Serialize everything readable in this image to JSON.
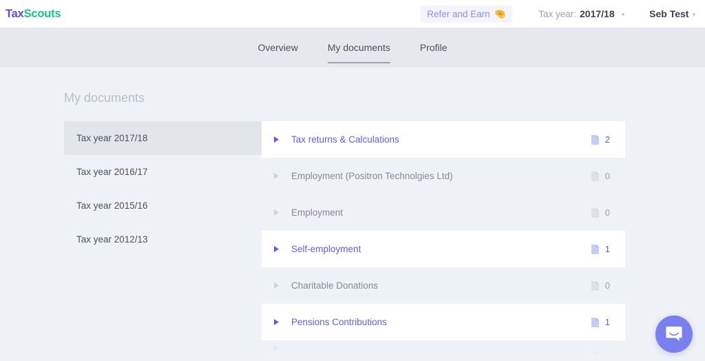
{
  "header": {
    "logo_tax": "Tax",
    "logo_scouts": "Scouts",
    "refer_label": "Refer and Earn",
    "refer_icon": "pinching-hand-emoji",
    "refer_emoji_glyph": "🤏",
    "tax_year_label": "Tax year:",
    "tax_year_value": "2017/18",
    "tax_year_caret": "▾",
    "user_name": "Seb Test",
    "user_caret": "▾"
  },
  "nav": {
    "tabs": [
      {
        "label": "Overview",
        "active": false
      },
      {
        "label": "My documents",
        "active": true
      },
      {
        "label": "Profile",
        "active": false
      }
    ]
  },
  "page": {
    "title": "My documents"
  },
  "sidebar": {
    "items": [
      {
        "label": "Tax year 2017/18",
        "active": true
      },
      {
        "label": "Tax year 2016/17",
        "active": false
      },
      {
        "label": "Tax year 2015/16",
        "active": false
      },
      {
        "label": "Tax year 2012/13",
        "active": false
      }
    ]
  },
  "documents": {
    "rows": [
      {
        "label": "Tax returns & Calculations",
        "count": "2",
        "has_files": true
      },
      {
        "label": "Employment (Positron Technolgies Ltd)",
        "count": "0",
        "has_files": false
      },
      {
        "label": "Employment",
        "count": "0",
        "has_files": false
      },
      {
        "label": "Self-employment",
        "count": "1",
        "has_files": true
      },
      {
        "label": "Charitable Donations",
        "count": "0",
        "has_files": false
      },
      {
        "label": "Pensions Contributions",
        "count": "1",
        "has_files": true
      }
    ],
    "partial_row": {
      "label": "",
      "count": "0",
      "has_files": false
    }
  },
  "chat": {
    "icon": "speech-bubble-smile-icon",
    "accent_color": "#7a7ff0"
  },
  "colors": {
    "brand_purple": "#5c4ae6",
    "brand_green": "#13c97f",
    "link_indigo": "#5b5fe8",
    "muted_grey": "#9aa1ab",
    "page_bg": "#eef2f6",
    "nav_bg": "#e5e8ec",
    "sidebar_active_bg": "#e2e6ea"
  }
}
